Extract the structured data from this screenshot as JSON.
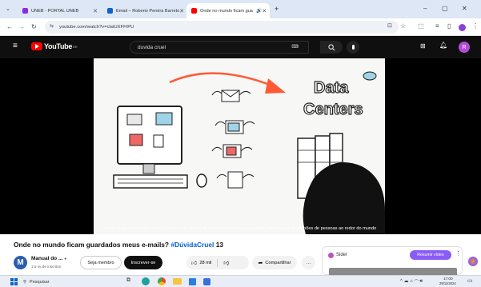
{
  "browser": {
    "tabs": [
      {
        "label": "UNEB - PORTAL UNEB"
      },
      {
        "label": "Email – Roberio Pereira Barreto"
      },
      {
        "label": "Onde no mundo ficam gua"
      }
    ],
    "new_tab": "+",
    "address": "youtube.com/watch?v=clatUXFFIPU",
    "window_controls": {
      "min": "–",
      "max": "▢",
      "close": "✕"
    }
  },
  "youtube": {
    "logo": "YouTube",
    "region": "BR",
    "search_query": "duvida cruel",
    "avatar_letter": "R"
  },
  "video": {
    "whiteboard_title_line1": "Data",
    "whiteboard_title_line2": "Centers",
    "subtitle": "Esses lugares chamam Data Centers, um monte de computadores que guardam informações de milhões de pessoas ao redor do mundo"
  },
  "meta": {
    "title": "Onde no mundo ficam guardados meus e-mails?",
    "title_hashtag": "#DúvidaCruel",
    "title_suffix": "13",
    "channel_name": "Manual do ...",
    "channel_initial": "M",
    "subscribers": "1,5 mi de inscritos",
    "join_label": "Seja membro",
    "subscribe_label": "Inscrever-se",
    "likes": "28 mil",
    "share_label": "Compartilhar",
    "more_label": "…"
  },
  "sider": {
    "label": "Sider",
    "summarize_label": "Resumir vídeo"
  },
  "taskbar": {
    "search_placeholder": "Pesquisar",
    "time": "17:00",
    "date": "29/11/2024"
  }
}
